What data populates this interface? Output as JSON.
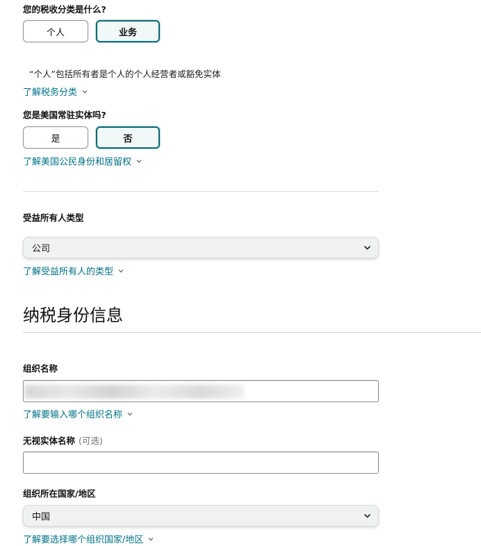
{
  "tax_classification": {
    "question": "您的税收分类是什么?",
    "options": [
      "个人",
      "业务"
    ],
    "selected": "业务",
    "help_text": "“个人”包括所有者是个人的个人经营者或豁免实体",
    "learn_link": "了解税务分类"
  },
  "us_resident": {
    "question": "您是美国常驻实体吗?",
    "options": [
      "是",
      "否"
    ],
    "selected": "否",
    "learn_link": "了解美国公民身份和居留权"
  },
  "beneficial_owner": {
    "label": "受益所有人类型",
    "value": "公司",
    "learn_link": "了解受益所有人的类型"
  },
  "tax_identity": {
    "section_title": "纳税身份信息",
    "org_name": {
      "label": "组织名称",
      "learn_link": "了解要输入哪个组织名称"
    },
    "disregarded_entity": {
      "label": "无视实体名称",
      "optional": "(可选)",
      "value": ""
    },
    "org_country": {
      "label": "组织所在国家/地区",
      "value": "中国",
      "learn_link": "了解要选择哪个组织国家/地区"
    }
  },
  "colors": {
    "link": "#007185",
    "selected_border": "#0c6b74",
    "select_bg": "#f0f2f2"
  }
}
